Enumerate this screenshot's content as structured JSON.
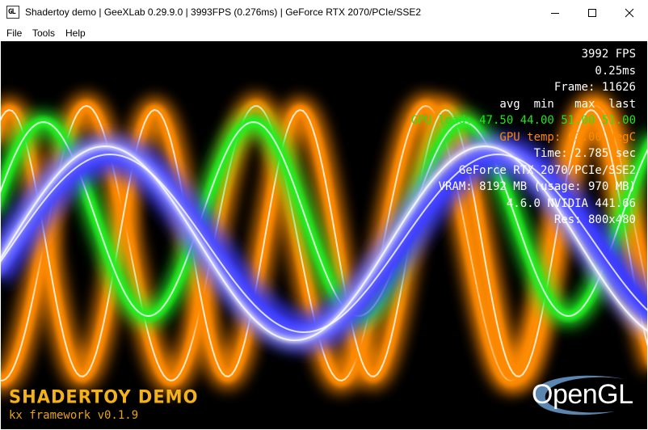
{
  "window": {
    "title": "Shadertoy demo | GeeXLab 0.29.9.0 | 3993FPS (0.276ms) | GeForce RTX 2070/PCIe/SSE2",
    "icon_text": "GL",
    "controls": [
      "minimize-icon",
      "maximize-icon",
      "close-icon"
    ]
  },
  "menu": {
    "file": "File",
    "tools": "Tools",
    "help": "Help"
  },
  "hud": {
    "fps": "3992 FPS",
    "frame_time": "0.25ms",
    "frame": "Frame: 11626",
    "stats_header": "avg  min   max  last",
    "gpu_load": "GPU load: 47.50 44.00 51.00 51.00",
    "gpu_temp": "GPU temp: 63.00 degC",
    "time": "Time: 2.785 sec",
    "renderer": "GeForce RTX 2070/PCIe/SSE2",
    "vram": "VRAM: 8192 MB (usage: 970 MB)",
    "gl_version": "4.6.0 NVIDIA 441.66",
    "resolution": "Res: 800x480"
  },
  "branding": {
    "demo_title": "SHADERTOY DEMO",
    "framework": "kx framework v0.1.9",
    "opengl_logo": "OpenGL"
  },
  "colors": {
    "wave_orange": "#ff8a00",
    "wave_green": "#22ee22",
    "wave_blue": "#3a3aff",
    "wave_white": "#ffffff",
    "hud_text": "#ffffff",
    "hud_green": "#1ee81e",
    "hud_orange": "#ff8a00",
    "logo_gold": "#f4b21a",
    "opengl_swoosh": "#5b86b0",
    "background": "#000000"
  }
}
